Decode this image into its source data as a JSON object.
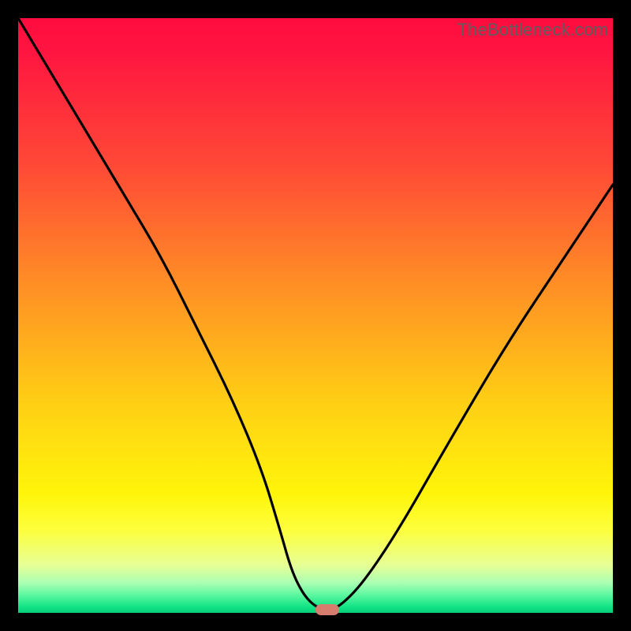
{
  "watermark": "TheBottleneck.com",
  "chart_data": {
    "type": "line",
    "title": "",
    "xlabel": "",
    "ylabel": "",
    "xlim": [
      0,
      100
    ],
    "ylim": [
      0,
      100
    ],
    "grid": false,
    "legend": false,
    "series": [
      {
        "name": "bottleneck-curve",
        "x": [
          0,
          6,
          12,
          18,
          24,
          30,
          36,
          41,
          44,
          46,
          48,
          50,
          52,
          54,
          58,
          64,
          72,
          82,
          92,
          100
        ],
        "y": [
          100,
          90,
          80,
          70,
          60,
          48,
          36,
          24,
          14,
          7,
          3,
          1,
          0.5,
          1,
          5,
          14,
          28,
          45,
          60,
          72
        ]
      }
    ],
    "marker": {
      "x": 52,
      "y": 0.5,
      "color": "#d67d6d"
    },
    "gradient_stops": [
      {
        "pos": 0,
        "color": "#ff0b3f"
      },
      {
        "pos": 25,
        "color": "#ff4a36"
      },
      {
        "pos": 45,
        "color": "#ff8f25"
      },
      {
        "pos": 65,
        "color": "#ffd014"
      },
      {
        "pos": 86,
        "color": "#fdff3c"
      },
      {
        "pos": 95,
        "color": "#a9ffb4"
      },
      {
        "pos": 100,
        "color": "#07d07a"
      }
    ]
  }
}
